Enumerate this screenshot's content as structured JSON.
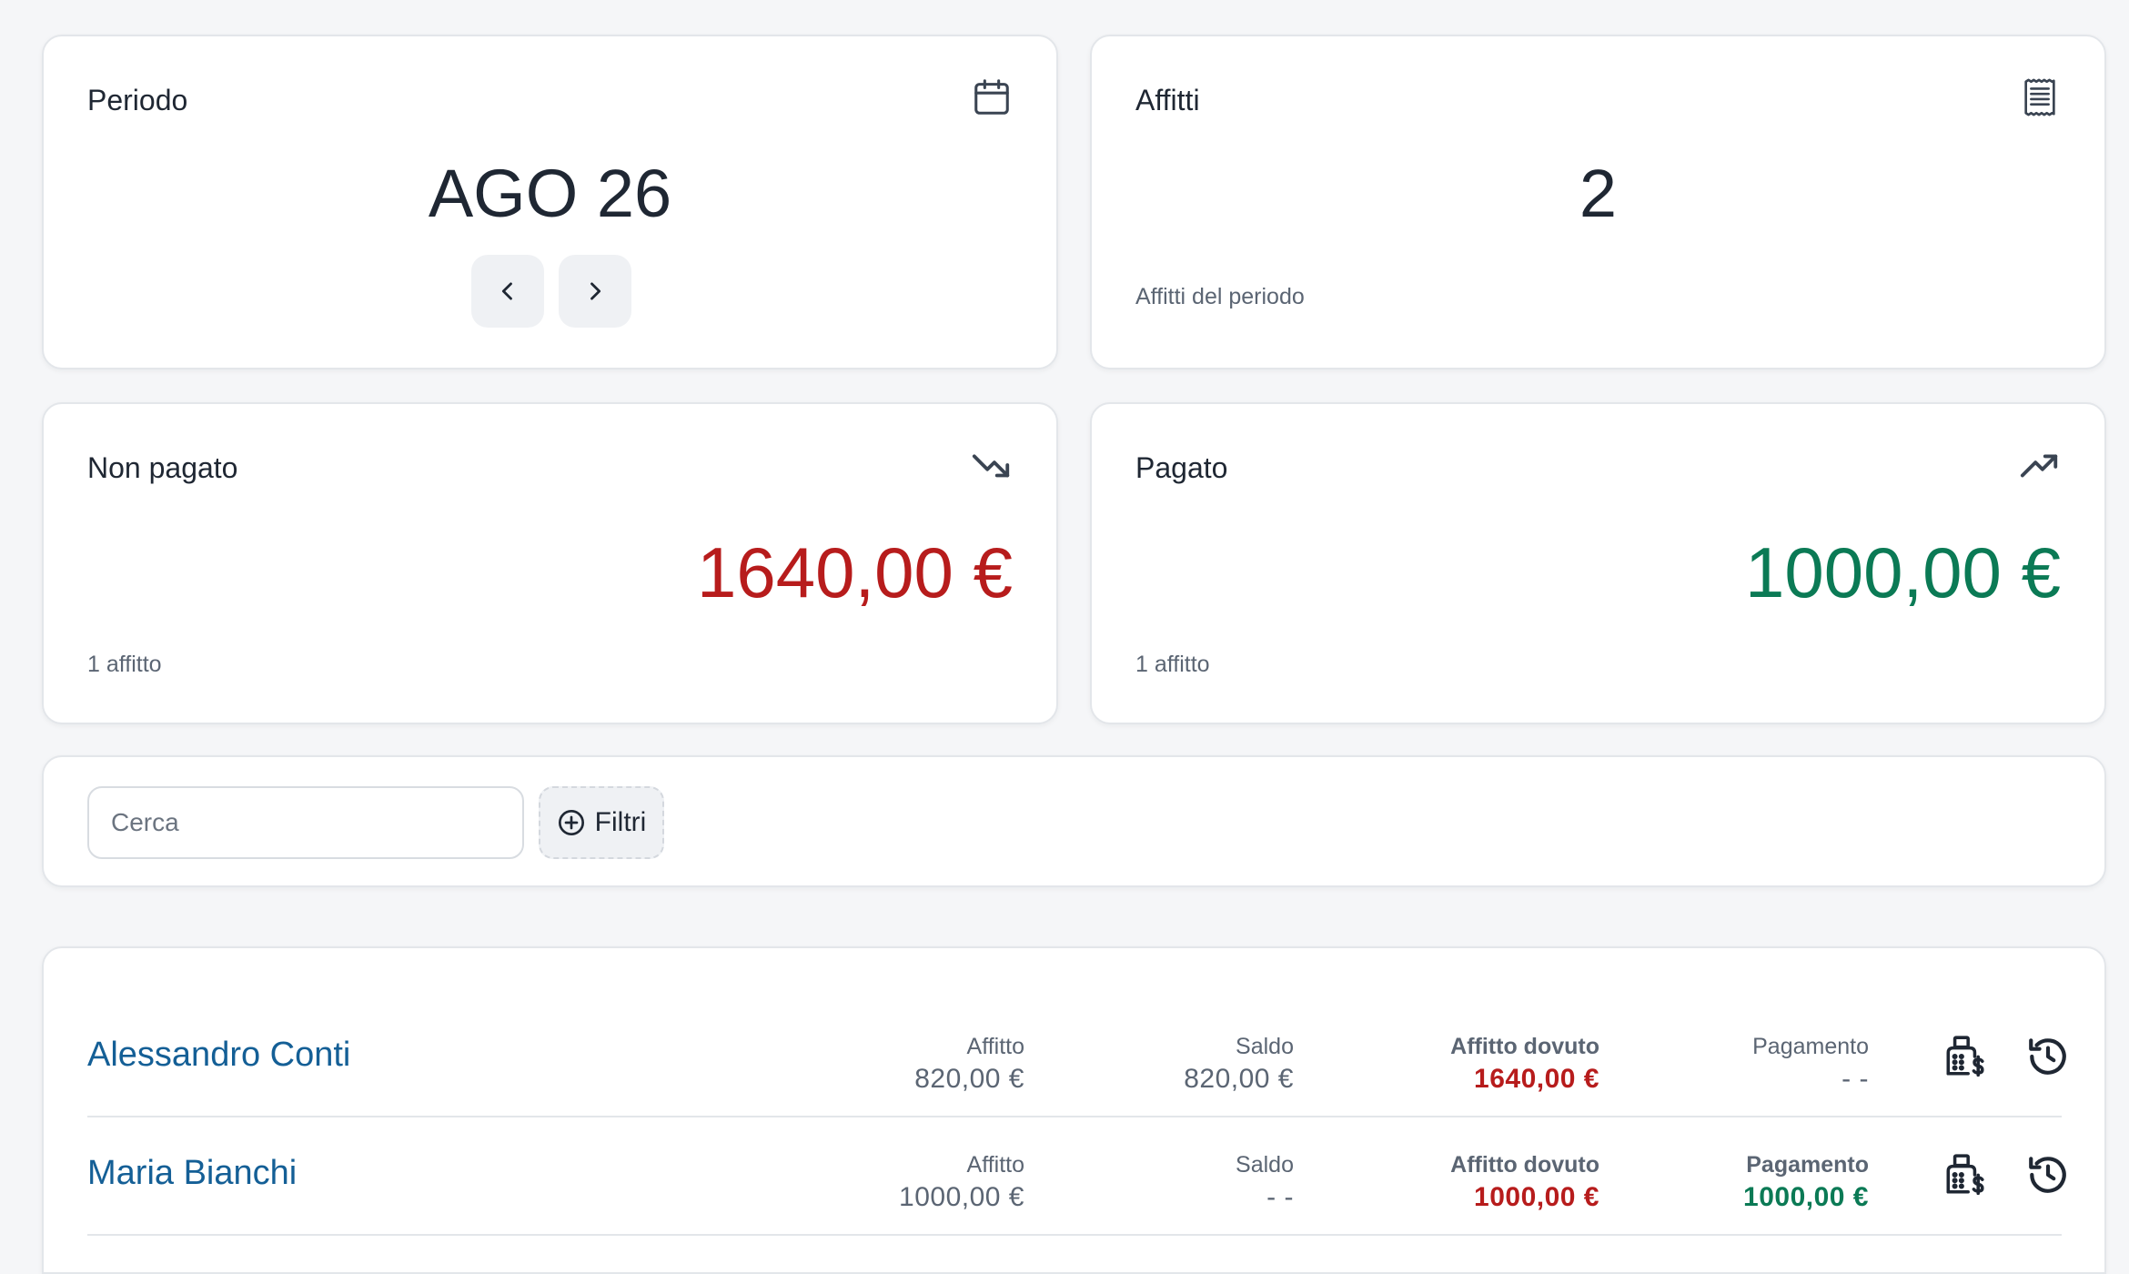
{
  "colors": {
    "accent_red": "#b71c1c",
    "accent_green": "#0b7a55",
    "link_blue": "#145f96"
  },
  "period_card": {
    "title": "Periodo",
    "icon": "calendar-icon",
    "value": "AGO 26"
  },
  "rents_card": {
    "title": "Affitti",
    "icon": "receipt-icon",
    "value": "2",
    "subtitle": "Affitti del periodo"
  },
  "unpaid_card": {
    "title": "Non pagato",
    "icon": "trending-down-icon",
    "value": "1640,00 €",
    "subtitle": "1 affitto"
  },
  "paid_card": {
    "title": "Pagato",
    "icon": "trending-up-icon",
    "value": "1000,00 €",
    "subtitle": "1 affitto"
  },
  "search": {
    "placeholder": "Cerca",
    "value": "",
    "filters_label": "Filtri"
  },
  "rows": [
    {
      "tenant": "Alessandro Conti",
      "rent_label": "Affitto",
      "rent": "820,00 €",
      "balance_label": "Saldo",
      "balance": "820,00 €",
      "due_label": "Affitto dovuto",
      "due": "1640,00 €",
      "payment_label": "Pagamento",
      "payment": "- -"
    },
    {
      "tenant": "Maria Bianchi",
      "rent_label": "Affitto",
      "rent": "1000,00 €",
      "balance_label": "Saldo",
      "balance": "- -",
      "due_label": "Affitto dovuto",
      "due": "1000,00 €",
      "payment_label": "Pagamento",
      "payment": "1000,00 €"
    }
  ]
}
